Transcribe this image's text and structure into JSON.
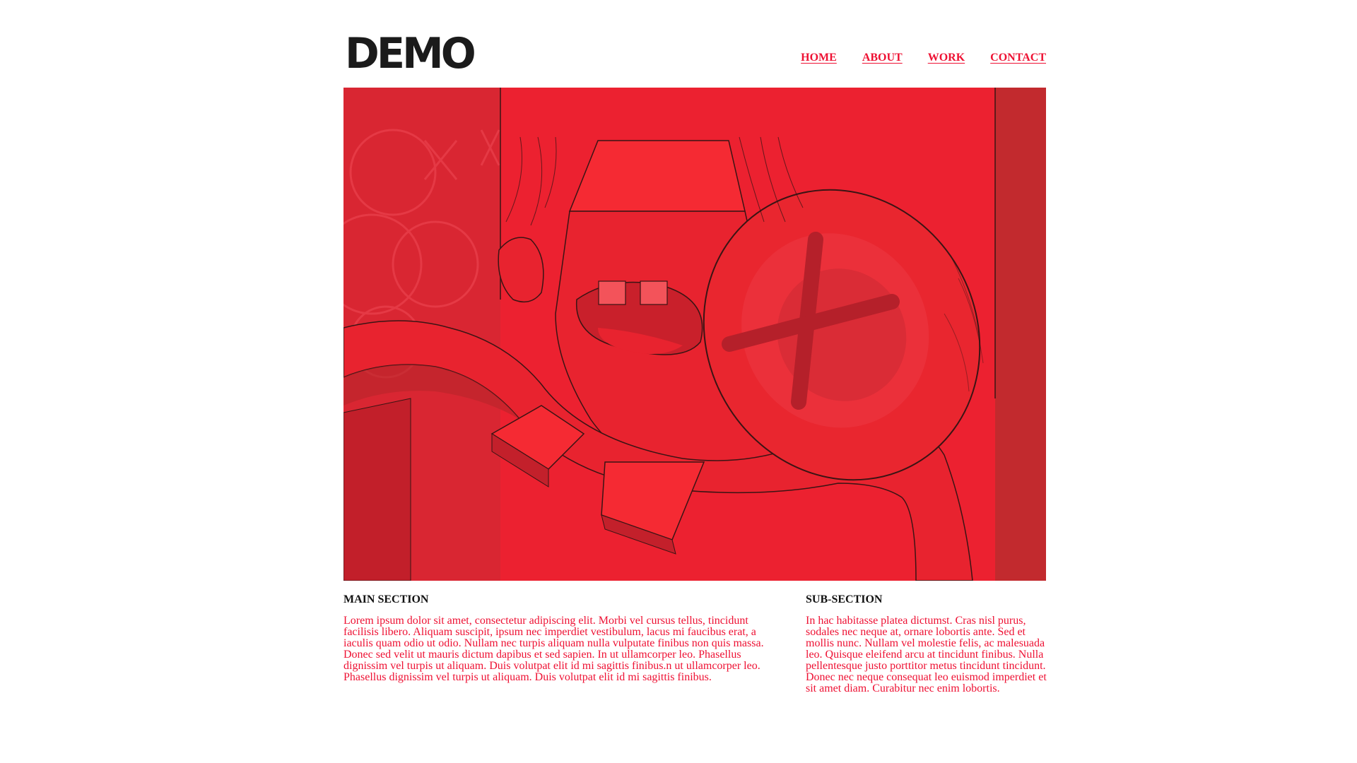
{
  "header": {
    "logo_text": "DEMO",
    "nav": [
      {
        "label": "HOME"
      },
      {
        "label": "ABOUT"
      },
      {
        "label": "WORK"
      },
      {
        "label": "CONTACT"
      }
    ]
  },
  "hero": {
    "image": "red-cartoon-artwork"
  },
  "main_section": {
    "title": "MAIN SECTION",
    "body": "Lorem ipsum dolor sit amet, consectetur adipiscing elit. Morbi vel cursus tellus, tincidunt facilisis libero. Aliquam suscipit, ipsum nec imperdiet vestibulum, lacus mi faucibus erat, a iaculis quam odio ut odio. Nullam nec turpis aliquam nulla vulputate finibus non quis massa. Donec sed velit ut mauris dictum dapibus et sed sapien. In ut ullamcorper leo. Phasellus dignissim vel turpis ut aliquam. Duis volutpat elit id mi sagittis finibus.n ut ullamcorper leo. Phasellus dignissim vel turpis ut aliquam. Duis volutpat elit id mi sagittis finibus."
  },
  "sub_section": {
    "title": "SUB-SECTION",
    "body": "In hac habitasse platea dictumst. Cras nisl purus, sodales nec neque at, ornare lobortis ante. Sed et mollis nunc. Nullam vel molestie felis, ac malesuada leo. Quisque eleifend arcu at tincidunt finibus. Nulla pellentesque justo porttitor metus tincidunt tincidunt. Donec nec neque consequat leo euismod imperdiet et sit amet diam. Curabitur nec enim lobortis."
  },
  "colors": {
    "accent": "#ee1133",
    "heading": "#111111",
    "logo": "#1b1b1b",
    "background": "#ffffff"
  }
}
